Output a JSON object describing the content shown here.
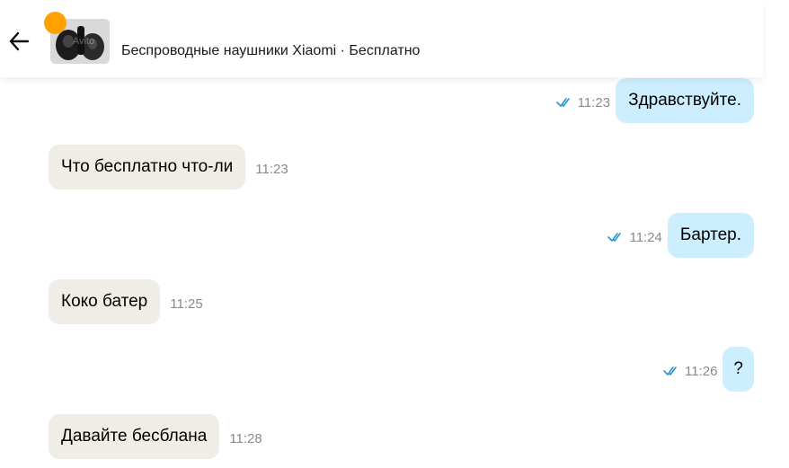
{
  "header": {
    "title": "Беспроводные наушники Xiaomi · Бесплатно",
    "thumb_watermark": "Avito",
    "status_dot_color": "#ffa200"
  },
  "colors": {
    "incoming_bubble": "#f0ede6",
    "outgoing_bubble": "#cdeeff",
    "read_ticks": "#2196d3",
    "time_text": "#8a8a8a"
  },
  "messages": [
    {
      "direction": "outgoing",
      "text": "Здравствуйте.",
      "time": "11:23",
      "read": true
    },
    {
      "direction": "incoming",
      "text": "Что бесплатно что-ли",
      "time": "11:23"
    },
    {
      "direction": "outgoing",
      "text": "Бартер.",
      "time": "11:24",
      "read": true
    },
    {
      "direction": "incoming",
      "text": "Коко батер",
      "time": "11:25"
    },
    {
      "direction": "outgoing",
      "text": "?",
      "time": "11:26",
      "read": true
    },
    {
      "direction": "incoming",
      "text": "Давайте бесблана",
      "time": "11:28"
    }
  ]
}
